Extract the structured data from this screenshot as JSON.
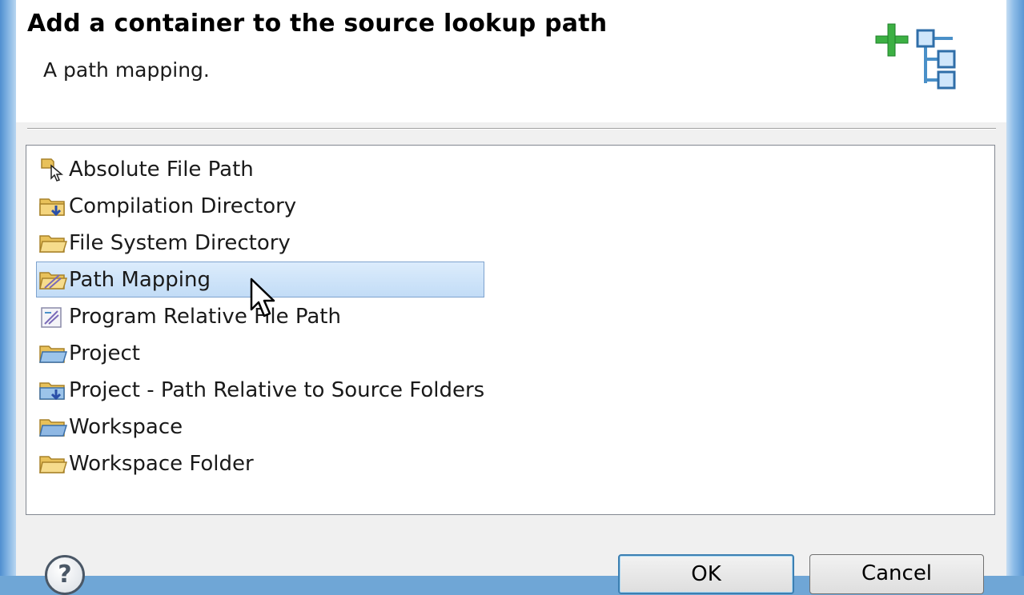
{
  "dialog": {
    "title": "Add a container to the source lookup path",
    "subtitle": "A path mapping.",
    "header_icon": "add-container-tree-icon"
  },
  "list": {
    "selected_index": 3,
    "items": [
      {
        "label": "Absolute File Path",
        "icon": "absolute-file-path-icon"
      },
      {
        "label": "Compilation Directory",
        "icon": "compilation-directory-icon"
      },
      {
        "label": "File System Directory",
        "icon": "folder-icon"
      },
      {
        "label": "Path Mapping",
        "icon": "path-mapping-icon"
      },
      {
        "label": "Program Relative File Path",
        "icon": "program-relative-path-icon"
      },
      {
        "label": "Project",
        "icon": "project-folder-icon"
      },
      {
        "label": "Project - Path Relative to Source Folders",
        "icon": "project-relative-folder-icon"
      },
      {
        "label": "Workspace",
        "icon": "workspace-folder-icon"
      },
      {
        "label": "Workspace Folder",
        "icon": "folder-icon"
      }
    ]
  },
  "buttons": {
    "help": "?",
    "ok": "OK",
    "cancel": "Cancel"
  },
  "colors": {
    "selection": "#cce8ff",
    "selection_border": "#7da2ce",
    "folder": "#e8c15a",
    "plus": "#3cb043",
    "tree_node": "#4a90c8"
  }
}
